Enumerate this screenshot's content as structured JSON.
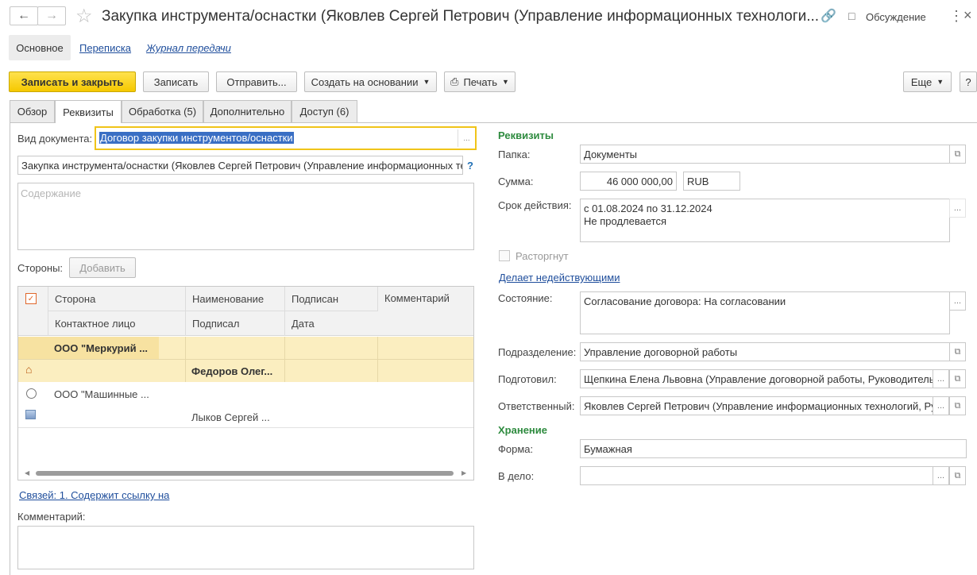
{
  "window": {
    "title": "Закупка инструмента/оснастки (Яковлев Сергей Петрович (Управление информационных технологи...",
    "discussion_label": "Обсуждение"
  },
  "top_nav": {
    "main": "Основное",
    "correspondence": "Переписка",
    "transfer_log": "Журнал передачи"
  },
  "toolbar": {
    "save_close": "Записать и закрыть",
    "save": "Записать",
    "send": "Отправить...",
    "create_based": "Создать на основании",
    "print": "Печать",
    "more": "Еще",
    "help": "?"
  },
  "tabs": [
    "Обзор",
    "Реквизиты",
    "Обработка (5)",
    "Дополнительно",
    "Доступ (6)"
  ],
  "left": {
    "doc_type_label": "Вид документа:",
    "doc_type_value": "Договор закупки инструментов/оснастки",
    "subject_value": "Закупка инструмента/оснастки (Яковлев Сергей Петрович (Управление информационных тех",
    "help_mark": "?",
    "content_placeholder": "Содержание",
    "parties_label": "Стороны:",
    "add_button": "Добавить",
    "table": {
      "headers_row1": [
        "Сторона",
        "Наименование",
        "Подписан",
        "Комментарий"
      ],
      "headers_row2": [
        "Контактное лицо",
        "Подписал",
        "Дата"
      ],
      "rows": [
        {
          "party": "ООО \"Меркурий ...",
          "signer": ""
        },
        {
          "party": "",
          "signer": "Федоров Олег..."
        },
        {
          "party": "ООО \"Машинные ...",
          "signer": ""
        },
        {
          "party": "",
          "signer": "Лыков Сергей ..."
        }
      ]
    },
    "links_text": "Связей: 1. Содержит ссылку на",
    "comment_label": "Комментарий:"
  },
  "right": {
    "requisites_title": "Реквизиты",
    "folder_label": "Папка:",
    "folder_value": "Документы",
    "sum_label": "Сумма:",
    "sum_value": "46 000 000,00",
    "currency_value": "RUB",
    "validity_label": "Срок действия:",
    "validity_line1": "с 01.08.2024 по 31.12.2024",
    "validity_line2": "Не продлевается",
    "terminated_label": "Расторгнут",
    "invalidates_link": "Делает недействующими",
    "state_label": "Состояние:",
    "state_value": "Согласование договора: На согласовании",
    "department_label": "Подразделение:",
    "department_value": "Управление договорной работы",
    "prepared_label": "Подготовил:",
    "prepared_value": "Щепкина Елена Львовна (Управление договорной работы, Руководитель",
    "responsible_label": "Ответственный:",
    "responsible_value": "Яковлев Сергей Петрович (Управление информационных технологий, Ру",
    "storage_title": "Хранение",
    "form_label": "Форма:",
    "form_value": "Бумажная",
    "case_label": "В дело:",
    "case_value": ""
  }
}
